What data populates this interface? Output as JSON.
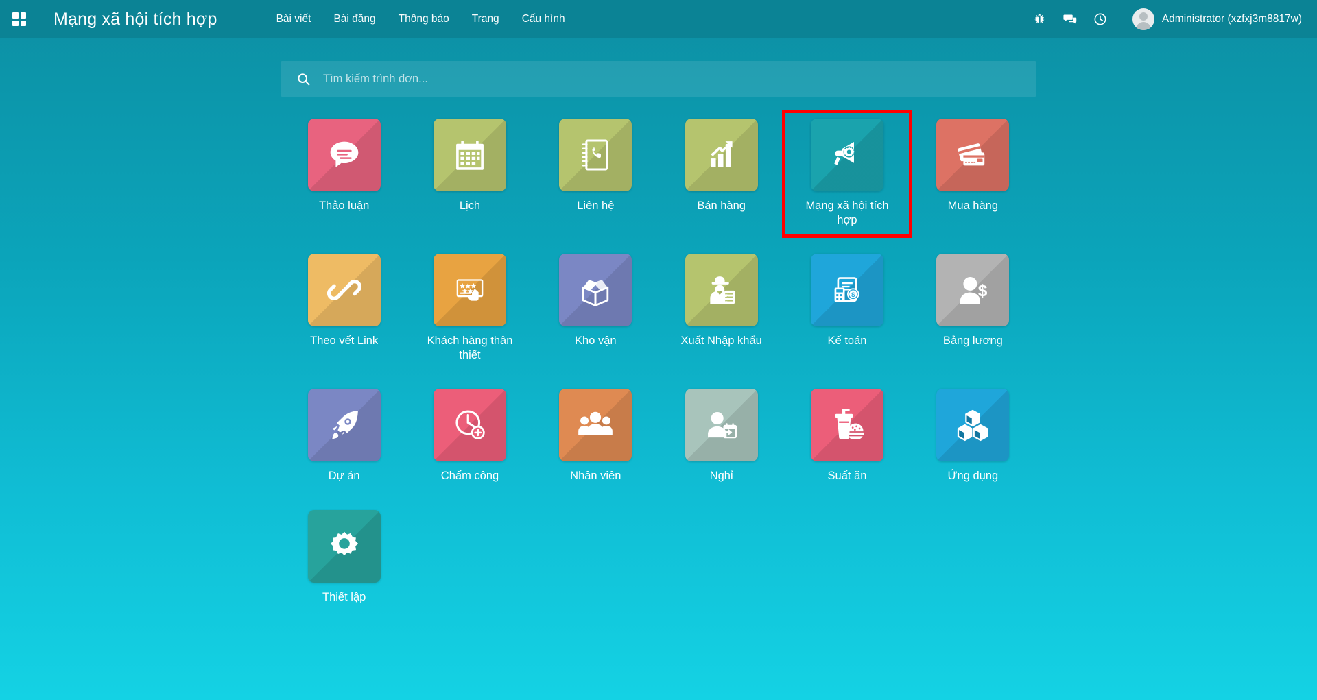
{
  "header": {
    "apps_menu_icon": "grid-icon",
    "title": "Mạng xã hội tích hợp",
    "nav": [
      {
        "label": "Bài viết"
      },
      {
        "label": "Bài đăng"
      },
      {
        "label": "Thông báo"
      },
      {
        "label": "Trang"
      },
      {
        "label": "Cấu hình"
      }
    ],
    "icons": [
      {
        "name": "bug-icon"
      },
      {
        "name": "chat-icon"
      },
      {
        "name": "clock-icon"
      }
    ],
    "user": {
      "avatar": "user-avatar",
      "name": "Administrator (xzfxj3m8817w)"
    },
    "background_color": "#0b8395"
  },
  "search": {
    "icon": "search-icon",
    "placeholder": "Tìm kiếm trình đơn...",
    "value": ""
  },
  "apps": [
    {
      "label": "Thảo luận",
      "icon": "chat-bubble-icon",
      "color": "#e8637f",
      "selected": false
    },
    {
      "label": "Lịch",
      "icon": "calendar-icon",
      "color": "#b5c46e",
      "selected": false
    },
    {
      "label": "Liên hệ",
      "icon": "phone-book-icon",
      "color": "#b5c46e",
      "selected": false
    },
    {
      "label": "Bán hàng",
      "icon": "bar-chart-arrow-icon",
      "color": "#b5c46e",
      "selected": false
    },
    {
      "label": "Mạng xã hội tích hợp",
      "icon": "megaphone-gear-icon",
      "color": "#1aa3ad",
      "selected": true
    },
    {
      "label": "Mua hàng",
      "icon": "credit-cards-icon",
      "color": "#dd7264",
      "selected": false
    },
    {
      "label": "Theo vết Link",
      "icon": "link-chain-icon",
      "color": "#eebb64",
      "selected": false
    },
    {
      "label": "Khách hàng thân thiết",
      "icon": "loyalty-card-icon",
      "color": "#e8a341",
      "selected": false
    },
    {
      "label": "Kho vận",
      "icon": "open-box-icon",
      "color": "#7b87c4",
      "selected": false
    },
    {
      "label": "Xuất Nhập khẩu",
      "icon": "customs-officer-icon",
      "color": "#b5c46e",
      "selected": false
    },
    {
      "label": "Kế toán",
      "icon": "invoice-calculator-icon",
      "color": "#1fa6da",
      "selected": false
    },
    {
      "label": "Bảng lương",
      "icon": "person-dollar-icon",
      "color": "#b3b3b3",
      "selected": false
    },
    {
      "label": "Dự án",
      "icon": "rocket-icon",
      "color": "#7b87c4",
      "selected": false
    },
    {
      "label": "Chấm công",
      "icon": "clock-plus-icon",
      "color": "#ec5e79",
      "selected": false
    },
    {
      "label": "Nhân viên",
      "icon": "people-group-icon",
      "color": "#df8a52",
      "selected": false
    },
    {
      "label": "Nghỉ",
      "icon": "person-leave-icon",
      "color": "#a8c4bb",
      "selected": false
    },
    {
      "label": "Suất ăn",
      "icon": "food-drink-icon",
      "color": "#ec5e79",
      "selected": false
    },
    {
      "label": "Ứng dụng",
      "icon": "cubes-icon",
      "color": "#1fa6da",
      "selected": false
    },
    {
      "label": "Thiết lập",
      "icon": "gear-icon",
      "color": "#27a39c",
      "selected": false
    }
  ],
  "theme": {
    "background_top": "#0d8fa3",
    "background_bottom": "#14d2e4",
    "highlight_border": "#ff0000"
  }
}
